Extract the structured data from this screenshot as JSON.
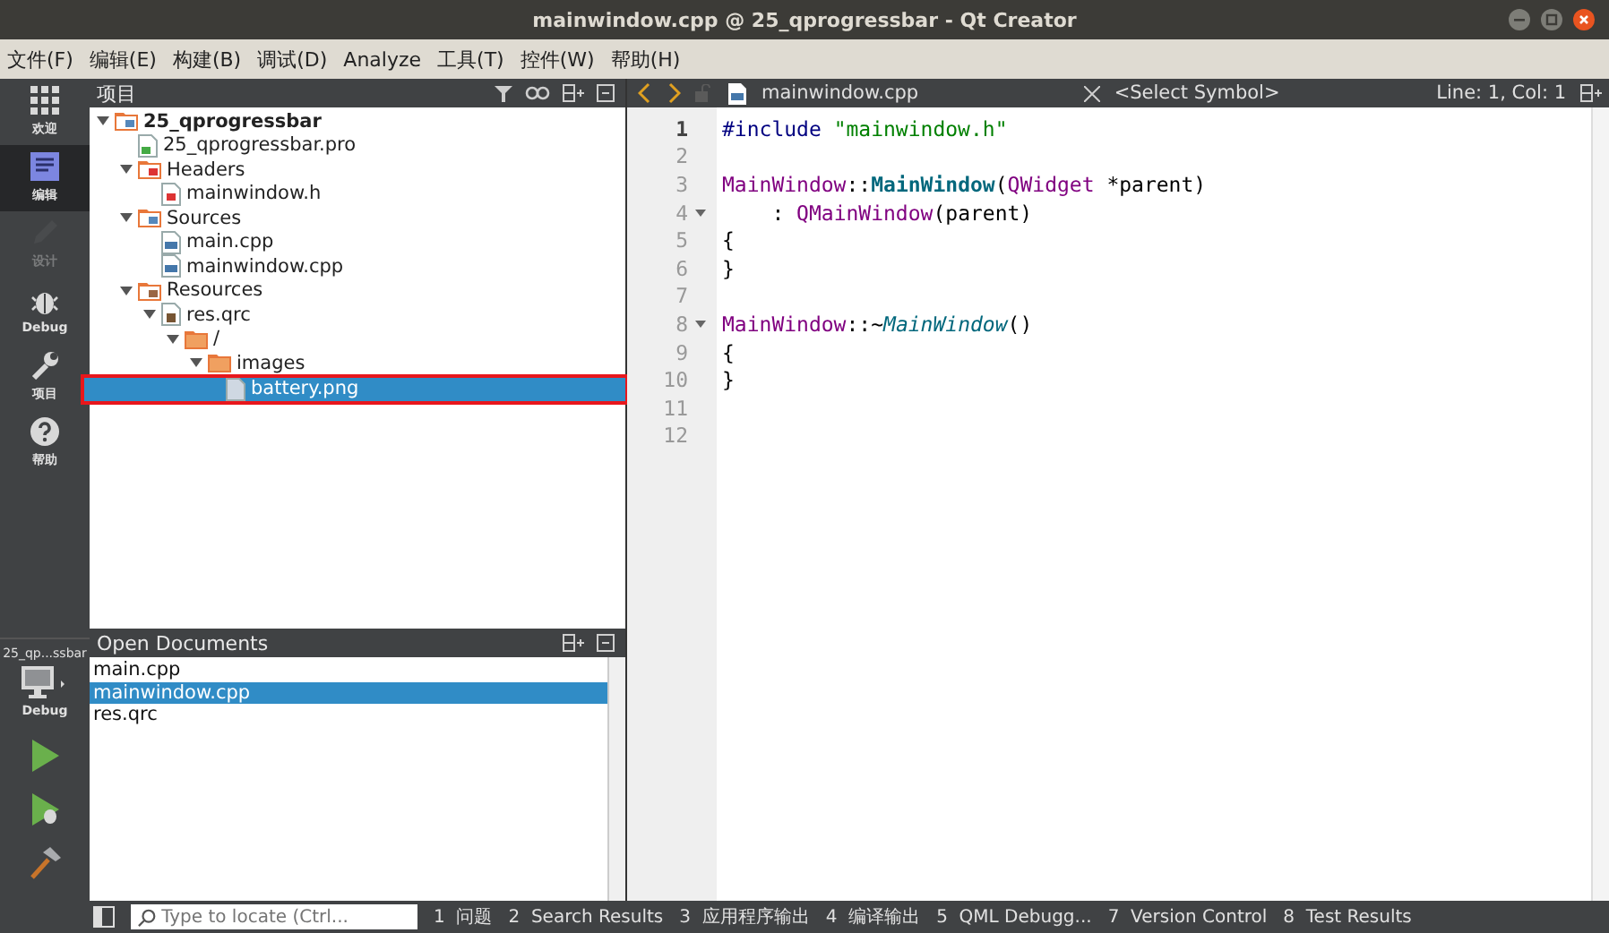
{
  "window": {
    "title": "mainwindow.cpp @ 25_qprogressbar - Qt Creator"
  },
  "menu": [
    {
      "label": "文件(F)"
    },
    {
      "label": "编辑(E)"
    },
    {
      "label": "构建(B)"
    },
    {
      "label": "调试(D)"
    },
    {
      "label": "Analyze"
    },
    {
      "label": "工具(T)"
    },
    {
      "label": "控件(W)"
    },
    {
      "label": "帮助(H)"
    }
  ],
  "modes": [
    {
      "label": "欢迎",
      "kind": "grid",
      "selected": false,
      "disabled": false
    },
    {
      "label": "编辑",
      "kind": "edit",
      "selected": true,
      "disabled": false
    },
    {
      "label": "设计",
      "kind": "pencil",
      "selected": false,
      "disabled": true
    },
    {
      "label": "Debug",
      "kind": "bug",
      "selected": false,
      "disabled": false
    },
    {
      "label": "项目",
      "kind": "wrench",
      "selected": false,
      "disabled": false
    },
    {
      "label": "帮助",
      "kind": "help",
      "selected": false,
      "disabled": false
    }
  ],
  "kit": {
    "project": "25_qp...ssbar",
    "config": "Debug"
  },
  "project_panel": {
    "title": "项目",
    "tree": [
      {
        "label": "25_qprogressbar",
        "kind": "project",
        "expanded": true,
        "selected": false,
        "highlighted": false,
        "children": [
          {
            "label": "25_qprogressbar.pro",
            "kind": "pro",
            "selected": false,
            "highlighted": false
          },
          {
            "label": "Headers",
            "kind": "headers",
            "expanded": true,
            "selected": false,
            "highlighted": false,
            "children": [
              {
                "label": "mainwindow.h",
                "kind": "h",
                "selected": false,
                "highlighted": false
              }
            ]
          },
          {
            "label": "Sources",
            "kind": "sources",
            "expanded": true,
            "selected": false,
            "highlighted": false,
            "children": [
              {
                "label": "main.cpp",
                "kind": "cpp",
                "selected": false,
                "highlighted": false
              },
              {
                "label": "mainwindow.cpp",
                "kind": "cpp",
                "selected": false,
                "highlighted": false
              }
            ]
          },
          {
            "label": "Resources",
            "kind": "resources",
            "expanded": true,
            "selected": false,
            "highlighted": false,
            "children": [
              {
                "label": "res.qrc",
                "kind": "qrc",
                "expanded": true,
                "selected": false,
                "highlighted": false,
                "children": [
                  {
                    "label": "/",
                    "kind": "folder",
                    "expanded": true,
                    "selected": false,
                    "highlighted": false,
                    "children": [
                      {
                        "label": "images",
                        "kind": "folder",
                        "expanded": true,
                        "selected": false,
                        "highlighted": false,
                        "children": [
                          {
                            "label": "battery.png",
                            "kind": "file",
                            "selected": true,
                            "highlighted": true
                          }
                        ]
                      }
                    ]
                  }
                ]
              }
            ]
          }
        ]
      }
    ]
  },
  "open_documents": {
    "title": "Open Documents",
    "items": [
      {
        "label": "main.cpp",
        "selected": false
      },
      {
        "label": "mainwindow.cpp",
        "selected": true
      },
      {
        "label": "res.qrc",
        "selected": false
      }
    ]
  },
  "editor": {
    "file": "mainwindow.cpp",
    "symbol": "<Select Symbol>",
    "position": "Line: 1, Col: 1",
    "lines": [
      {
        "number": "1",
        "current": true,
        "fold": false,
        "tokens": [
          {
            "text": "#include ",
            "kind": "preproc"
          },
          {
            "text": "\"mainwindow.h\"",
            "kind": "string"
          }
        ]
      },
      {
        "number": "2",
        "current": false,
        "fold": false
      },
      {
        "number": "3",
        "current": false,
        "fold": false,
        "tokens": [
          {
            "text": "MainWindow",
            "kind": "type"
          },
          {
            "text": "::",
            "kind": "plain"
          },
          {
            "text": "MainWindow",
            "kind": "decl"
          },
          {
            "text": "(",
            "kind": "plain"
          },
          {
            "text": "QWidget",
            "kind": "type"
          },
          {
            "text": " *parent)",
            "kind": "plain"
          }
        ]
      },
      {
        "number": "4",
        "current": false,
        "fold": true,
        "tokens": [
          {
            "text": "    : ",
            "kind": "plain"
          },
          {
            "text": "QMainWindow",
            "kind": "type"
          },
          {
            "text": "(parent)",
            "kind": "plain"
          }
        ]
      },
      {
        "number": "5",
        "current": false,
        "fold": false,
        "tokens": [
          {
            "text": "{",
            "kind": "plain"
          }
        ]
      },
      {
        "number": "6",
        "current": false,
        "fold": false,
        "tokens": [
          {
            "text": "}",
            "kind": "plain"
          }
        ]
      },
      {
        "number": "7",
        "current": false,
        "fold": false
      },
      {
        "number": "8",
        "current": false,
        "fold": true,
        "tokens": [
          {
            "text": "MainWindow",
            "kind": "type"
          },
          {
            "text": "::~",
            "kind": "plain"
          },
          {
            "text": "MainWindow",
            "kind": "virtual"
          },
          {
            "text": "()",
            "kind": "plain"
          }
        ]
      },
      {
        "number": "9",
        "current": false,
        "fold": false,
        "tokens": [
          {
            "text": "{",
            "kind": "plain"
          }
        ]
      },
      {
        "number": "10",
        "current": false,
        "fold": false,
        "tokens": [
          {
            "text": "}",
            "kind": "plain"
          }
        ]
      },
      {
        "number": "11",
        "current": false,
        "fold": false
      },
      {
        "number": "12",
        "current": false,
        "fold": false
      }
    ]
  },
  "status_bar": {
    "locator": {
      "placeholder": "Type to locate (Ctrl..."
    },
    "panes": [
      {
        "number": "1",
        "label": "问题"
      },
      {
        "number": "2",
        "label": "Search Results"
      },
      {
        "number": "3",
        "label": "应用程序输出"
      },
      {
        "number": "4",
        "label": "编译输出"
      },
      {
        "number": "5",
        "label": "QML Debugg..."
      },
      {
        "number": "7",
        "label": "Version Control"
      },
      {
        "number": "8",
        "label": "Test Results"
      }
    ]
  }
}
